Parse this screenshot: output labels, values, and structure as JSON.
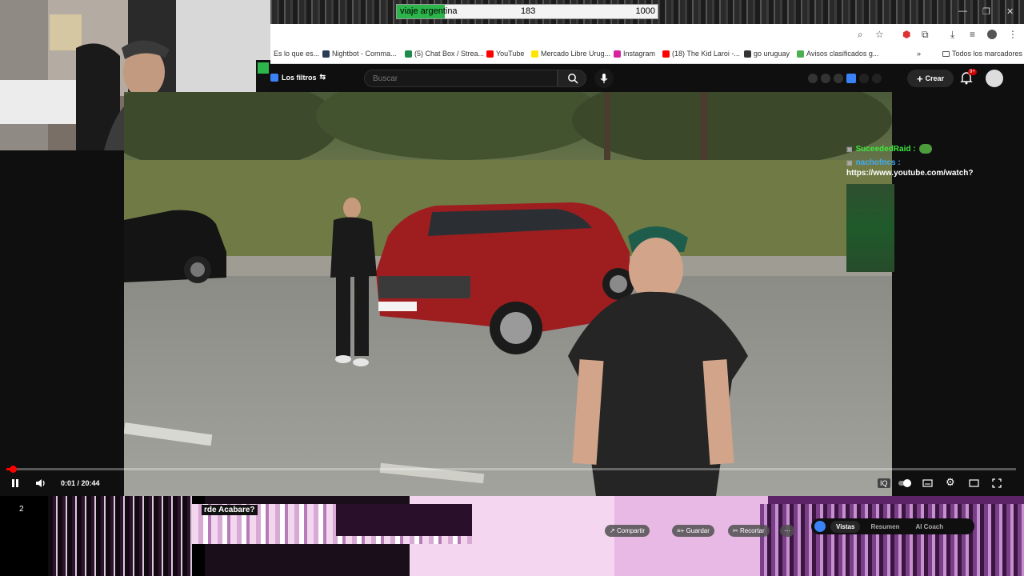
{
  "goal": {
    "title": "viaje argentina",
    "current": "183",
    "target": "1000",
    "progress": 0.183
  },
  "bookmarks": [
    {
      "label": "Es lo que es...",
      "color": "#888888"
    },
    {
      "label": "Nightbot - Comma...",
      "color": "#2b3a55"
    },
    {
      "label": "(5) Chat Box / Strea...",
      "color": "#1e8b4c"
    },
    {
      "label": "YouTube",
      "color": "#ff0000"
    },
    {
      "label": "Mercado Libre Urug...",
      "color": "#ffe600"
    },
    {
      "label": "Instagram",
      "color": "#d6249f"
    },
    {
      "label": "(18) The Kid Laroi -...",
      "color": "#ff0000"
    },
    {
      "label": "go uruguay",
      "color": "#333333"
    },
    {
      "label": "Avisos clasificados g...",
      "color": "#4caf50"
    }
  ],
  "all_bookmarks": "Todos los marcadores",
  "yt": {
    "filters_label": "Los filtros",
    "search_placeholder": "Buscar",
    "create_label": "Crear",
    "notif_count": "9+"
  },
  "chat": [
    {
      "user": "SuceededRaid :",
      "color": "green",
      "message": ""
    },
    {
      "user": "nachofncs :",
      "color": "blue",
      "message": "https://www.youtube.com/watch?"
    }
  ],
  "player": {
    "time": "0:01 / 20:44",
    "progress": 0.001
  },
  "bottom": {
    "number": "2",
    "title": "rde Acabare?",
    "tabs": [
      "Vistas",
      "Resumen",
      "AI Coach"
    ],
    "active_tab": 0,
    "actions": [
      "Compartir",
      "Guardar",
      "Recortar"
    ]
  },
  "colors": {
    "yt_red": "#ff0000",
    "chat_green": "#3ce93c",
    "chat_blue": "#3fa9f5"
  }
}
